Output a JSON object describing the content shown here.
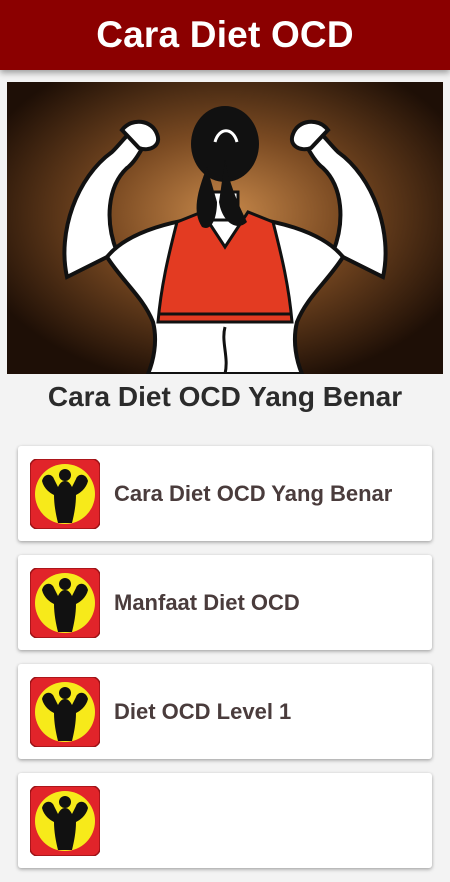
{
  "app_bar": {
    "title": "Cara Diet OCD"
  },
  "hero": {
    "image": "woman-flexing-back-red-sports-top"
  },
  "subtitle": "Cara Diet OCD Yang Benar",
  "colors": {
    "app_bar_bg": "#8b0000",
    "icon_bg_red": "#e1242a",
    "icon_circle_yellow": "#f7ea1a"
  },
  "menu": {
    "items": [
      {
        "label": "Cara Diet OCD Yang Benar",
        "icon": "bodybuilder-icon"
      },
      {
        "label": "Manfaat Diet OCD",
        "icon": "bodybuilder-icon"
      },
      {
        "label": "Diet OCD Level 1",
        "icon": "bodybuilder-icon"
      },
      {
        "label": "",
        "icon": "bodybuilder-icon"
      }
    ]
  }
}
